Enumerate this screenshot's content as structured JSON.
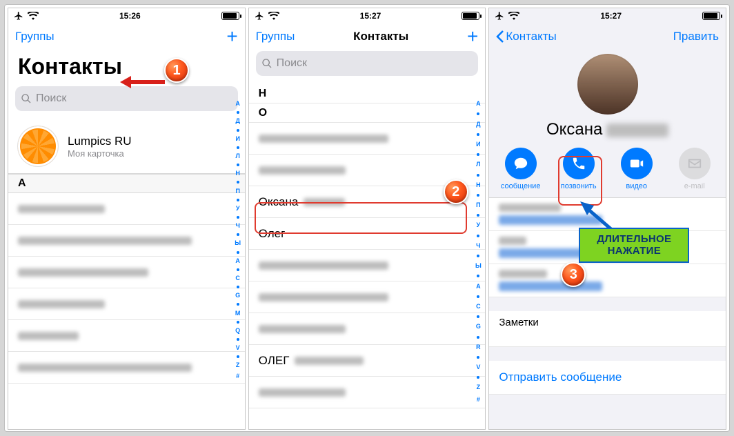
{
  "status": {
    "time1": "15:26",
    "time2": "15:27",
    "time3": "15:27"
  },
  "nav": {
    "groups": "Группы",
    "contacts_title": "Контакты",
    "back_contacts": "Контакты",
    "edit": "Править"
  },
  "large_title": "Контакты",
  "search_placeholder": "Поиск",
  "mycard": {
    "name": "Lumpics RU",
    "sub": "Моя карточка"
  },
  "section_A": "А",
  "section_N": "Н",
  "section_O": "О",
  "row_oksana": "Оксана",
  "row_oner": "Олег",
  "row_olet": "ОЛЕГ",
  "index_letters": [
    "А",
    "●",
    "Д",
    "●",
    "И",
    "●",
    "Л",
    "●",
    "Н",
    "●",
    "П",
    "●",
    "У",
    "●",
    "Ч",
    "●",
    "Ы",
    "●",
    "A",
    "●",
    "C",
    "●",
    "G",
    "●",
    "M",
    "●",
    "Q",
    "●",
    "V",
    "●",
    "Z",
    "#"
  ],
  "index_letters2": [
    "А",
    "●",
    "Д",
    "●",
    "И",
    "●",
    "Л",
    "●",
    "Н",
    "●",
    "П",
    "●",
    "У",
    "●",
    "Ч",
    "●",
    "Ы",
    "●",
    "A",
    "●",
    "C",
    "●",
    "G",
    "●",
    "R",
    "●",
    "V",
    "●",
    "Z",
    "#"
  ],
  "detail": {
    "name": "Оксана",
    "actions": {
      "message": "сообщение",
      "call": "позвонить",
      "video": "видео",
      "email": "e-mail"
    },
    "notes": "Заметки",
    "send_message": "Отправить сообщение"
  },
  "callout": "ДЛИТЕЛЬНОЕ НАЖАТИЕ",
  "badges": {
    "b1": "1",
    "b2": "2",
    "b3": "3"
  }
}
